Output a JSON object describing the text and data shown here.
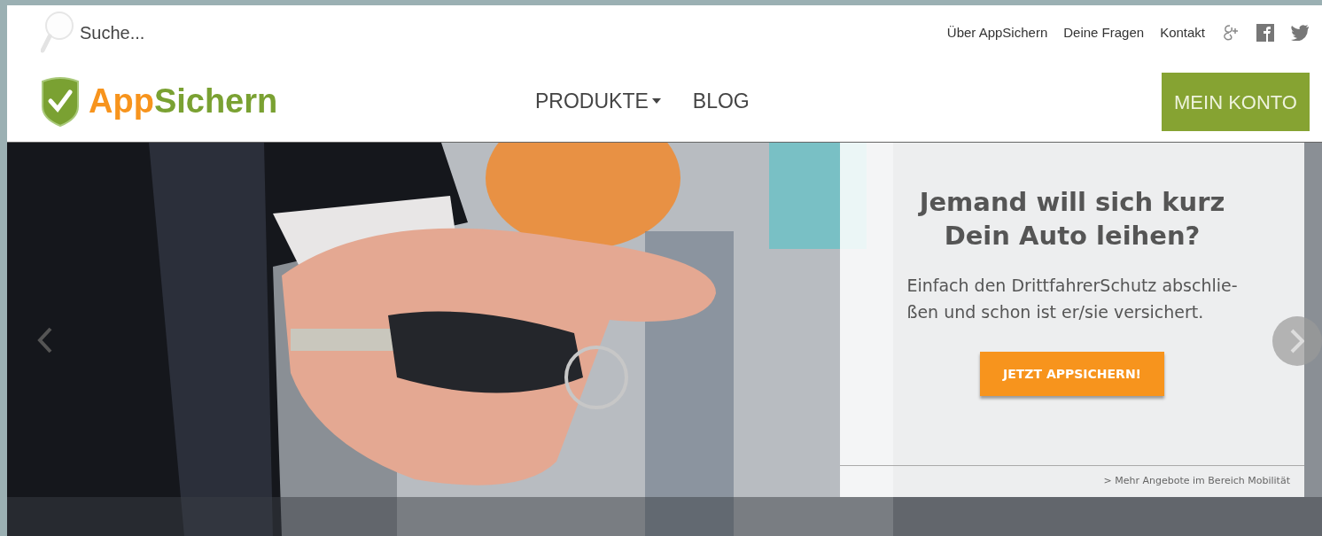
{
  "search": {
    "placeholder": "Suche..."
  },
  "top_links": [
    "Über AppSichern",
    "Deine Fragen",
    "Kontakt"
  ],
  "logo": {
    "part_1": "App",
    "part_2": "Sichern"
  },
  "nav": [
    {
      "label": "PRODUKTE",
      "dropdown": true
    },
    {
      "label": "BLOG",
      "dropdown": false
    }
  ],
  "account_button": "MEIN KONTO",
  "hero": {
    "card": {
      "heading": [
        "Jemand will sich kurz",
        "Dein Auto leihen?"
      ],
      "text": [
        "Einfach den DrittfahrerSchutz abschlie-",
        "ßen und schon ist er/sie versichert."
      ],
      "button": "JETZT APPSICHERN!",
      "footer_link": "> Mehr Angebote im Bereich Mobilität"
    }
  }
}
